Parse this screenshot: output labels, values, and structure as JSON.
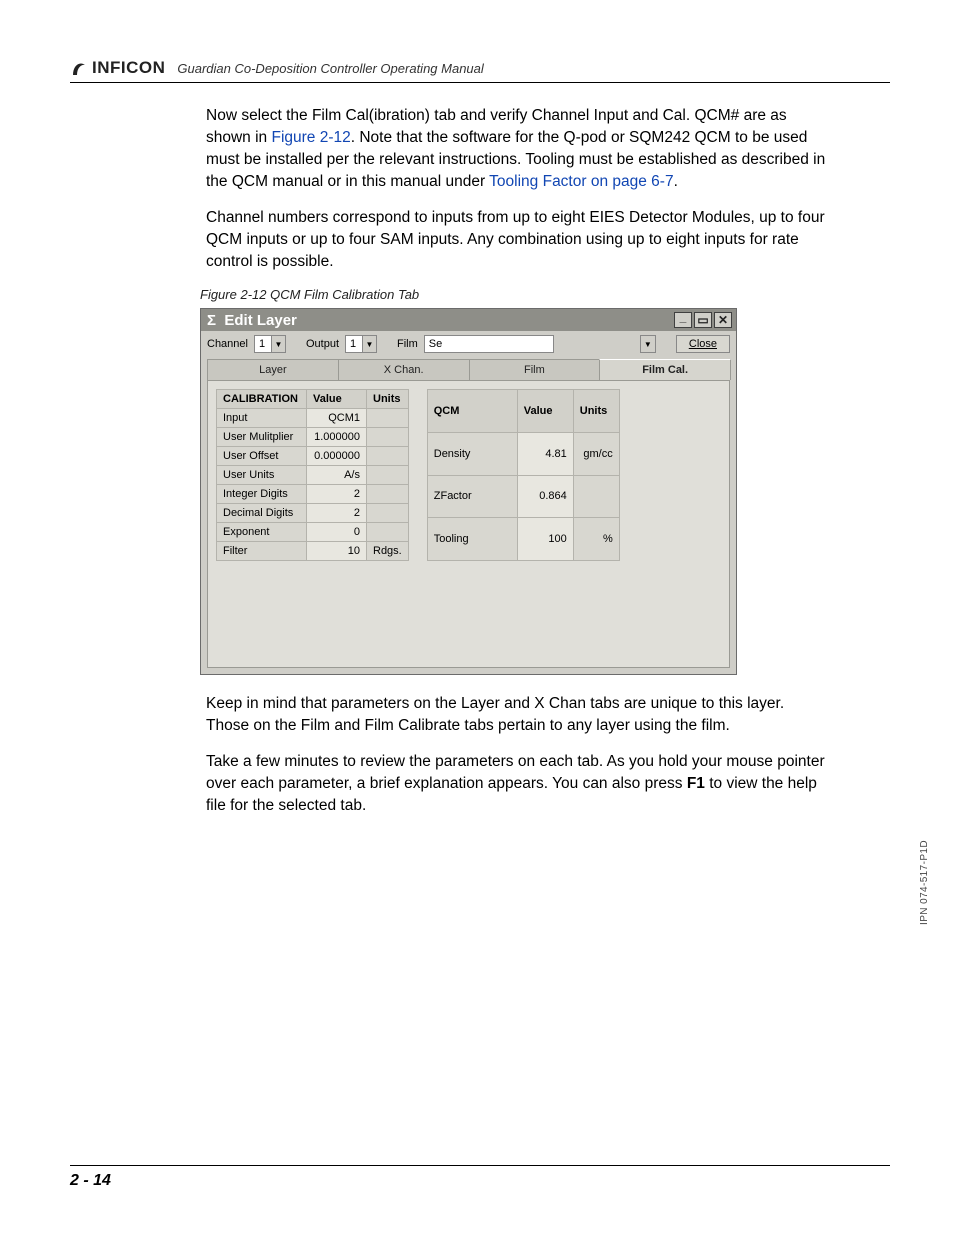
{
  "header": {
    "brand": "INFICON",
    "manual_title": "Guardian Co-Deposition Controller Operating Manual"
  },
  "para1a": "Now select the Film Cal(ibration) tab and verify Channel Input and Cal. QCM# are as shown in ",
  "para1_link1": "Figure 2-12",
  "para1b": ". Note that the software for the Q-pod or SQM242 QCM to be used must be installed per the relevant instructions. Tooling must be established as described in the QCM manual or in this manual under ",
  "para1_link2": "Tooling Factor on page 6-7",
  "para1c": ".",
  "para2": "Channel numbers correspond to inputs from up to eight EIES Detector Modules, up to four QCM inputs or up to four SAM inputs. Any combination using up to eight inputs for rate control is possible.",
  "fig_caption": "Figure 2-12  QCM Film Calibration Tab",
  "dialog": {
    "title_sigma": "Σ",
    "title": "Edit Layer",
    "toolbar": {
      "channel_label": "Channel",
      "channel_value": "1",
      "output_label": "Output",
      "output_value": "1",
      "film_label": "Film",
      "film_value": "Se",
      "close_label": "Close"
    },
    "tabs": [
      "Layer",
      "X Chan.",
      "Film",
      "Film Cal."
    ],
    "active_tab": 3,
    "cal_left": {
      "headers": [
        "CALIBRATION",
        "Value",
        "Units"
      ],
      "rows": [
        {
          "p": "Input",
          "v": "QCM1",
          "u": ""
        },
        {
          "p": "User Mulitplier",
          "v": "1.000000",
          "u": ""
        },
        {
          "p": "User Offset",
          "v": "0.000000",
          "u": ""
        },
        {
          "p": "User Units",
          "v": "A/s",
          "u": ""
        },
        {
          "p": "Integer Digits",
          "v": "2",
          "u": ""
        },
        {
          "p": "Decimal Digits",
          "v": "2",
          "u": ""
        },
        {
          "p": "Exponent",
          "v": "0",
          "u": ""
        },
        {
          "p": "Filter",
          "v": "10",
          "u": "Rdgs."
        }
      ]
    },
    "cal_right": {
      "headers": [
        "QCM",
        "Value",
        "Units"
      ],
      "rows": [
        {
          "p": "Density",
          "v": "4.81",
          "u": "gm/cc"
        },
        {
          "p": "ZFactor",
          "v": "0.864",
          "u": ""
        },
        {
          "p": "Tooling",
          "v": "100",
          "u": "%"
        }
      ]
    }
  },
  "para3": "Keep in mind that parameters on the Layer and X Chan tabs are unique to this layer. Those on the Film and Film Calibrate tabs pertain to any layer using the film.",
  "para4a": "Take a few minutes to review the parameters on each tab. As you hold your mouse pointer over each parameter, a brief explanation appears. You can also press ",
  "para4_bold": "F1",
  "para4b": " to view the help file for the selected tab.",
  "page_number": "2 - 14",
  "ipn": "IPN 074-517-P1D"
}
